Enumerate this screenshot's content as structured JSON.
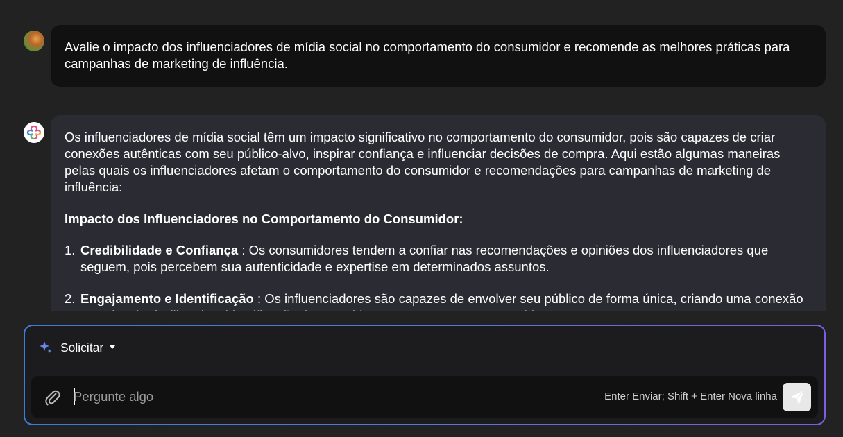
{
  "conversation": {
    "user_message": {
      "text": "Avalie o impacto dos influenciadores de mídia social no comportamento do consumidor e recomende as melhores práticas para campanhas de marketing de influência."
    },
    "assistant_message": {
      "intro": "Os influenciadores de mídia social têm um impacto significativo no comportamento do consumidor, pois são capazes de criar conexões autênticas com seu público-alvo, inspirar confiança e influenciar decisões de compra. Aqui estão algumas maneiras pelas quais os influenciadores afetam o comportamento do consumidor e recomendações para campanhas de marketing de influência:",
      "heading": "Impacto dos Influenciadores no Comportamento do Consumidor:",
      "items": [
        {
          "number": "1.",
          "title": "Credibilidade e Confiança",
          "text": " : Os consumidores tendem a confiar nas recomendações e opiniões dos influenciadores que seguem, pois percebem sua autenticidade e expertise em determinados assuntos."
        },
        {
          "number": "2.",
          "title": "Engajamento e Identificação",
          "text": " : Os influenciadores são capazes de envolver seu público de forma única, criando uma conexão emocional e facilitando a identificação dos seguidores com as marcas promovidas."
        }
      ]
    }
  },
  "composer": {
    "mode_label": "Solicitar",
    "input_placeholder": "Pergunte algo",
    "input_value": "",
    "hint": "Enter Enviar; Shift + Enter Nova linha"
  },
  "icons": {
    "mode": "sparkle-icon",
    "mode_dropdown": "caret-down-icon",
    "attach": "paperclip-icon",
    "send": "send-icon",
    "assistant_avatar": "assistant-logo-icon",
    "user_avatar": "user-avatar"
  },
  "colors": {
    "background": "#222222",
    "user_bubble": "#111111",
    "assistant_bubble": "#2b2b33",
    "composer_border_start": "#3f7bd9",
    "composer_border_end": "#7b5fe0",
    "send_button": "#e8e8e8"
  }
}
